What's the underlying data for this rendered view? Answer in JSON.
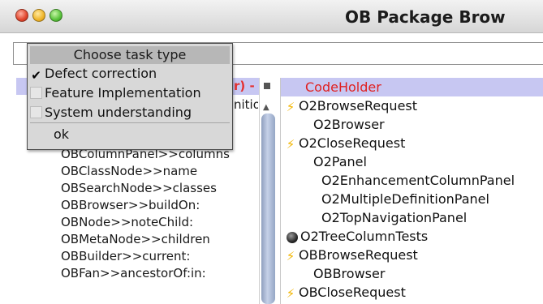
{
  "window": {
    "title": "OB Package Brow"
  },
  "dialog": {
    "title": "Choose task type",
    "options": [
      {
        "label": "Defect correction",
        "checked": true
      },
      {
        "label": "Feature Implementation",
        "checked": false
      },
      {
        "label": "System understanding",
        "checked": false
      }
    ],
    "ok_label": "ok",
    "checkmark_glyph": "✔"
  },
  "left_pane": {
    "selected_fragment": "r) -",
    "partial_fragment": "nitio",
    "items": [
      "OBColumnPanel>>columns",
      "OBClassNode>>name",
      "OBSearchNode>>classes",
      "OBBrowser>>buildOn:",
      "OBNode>>noteChild:",
      "OBMetaNode>>children",
      "OBBuilder>>current:",
      "OBFan>>ancestorOf:in:"
    ]
  },
  "right_pane": {
    "items": [
      {
        "label": "CodeHolder",
        "icon": "none",
        "indent": 0,
        "selected": true
      },
      {
        "label": "O2BrowseRequest",
        "icon": "lightning-icon",
        "indent": 0,
        "selected": false
      },
      {
        "label": "O2Browser",
        "icon": "none",
        "indent": 1,
        "selected": false
      },
      {
        "label": "O2CloseRequest",
        "icon": "lightning-icon",
        "indent": 0,
        "selected": false
      },
      {
        "label": "O2Panel",
        "icon": "none",
        "indent": 1,
        "selected": false
      },
      {
        "label": "O2EnhancementColumnPanel",
        "icon": "none",
        "indent": 2,
        "selected": false
      },
      {
        "label": "O2MultipleDefinitionPanel",
        "icon": "none",
        "indent": 2,
        "selected": false
      },
      {
        "label": "O2TopNavigationPanel",
        "icon": "none",
        "indent": 2,
        "selected": false
      },
      {
        "label": "O2TreeColumnTests",
        "icon": "dark-dot-icon",
        "indent": 0,
        "selected": false
      },
      {
        "label": "OBBrowseRequest",
        "icon": "lightning-icon",
        "indent": 0,
        "selected": false
      },
      {
        "label": "OBBrowser",
        "icon": "none",
        "indent": 1,
        "selected": false
      },
      {
        "label": "OBCloseRequest",
        "icon": "lightning-icon",
        "indent": 0,
        "selected": false
      }
    ]
  },
  "colors": {
    "selection_background": "#c7c7f2",
    "selection_text": "#e02020",
    "lightning": "#f2b500"
  }
}
